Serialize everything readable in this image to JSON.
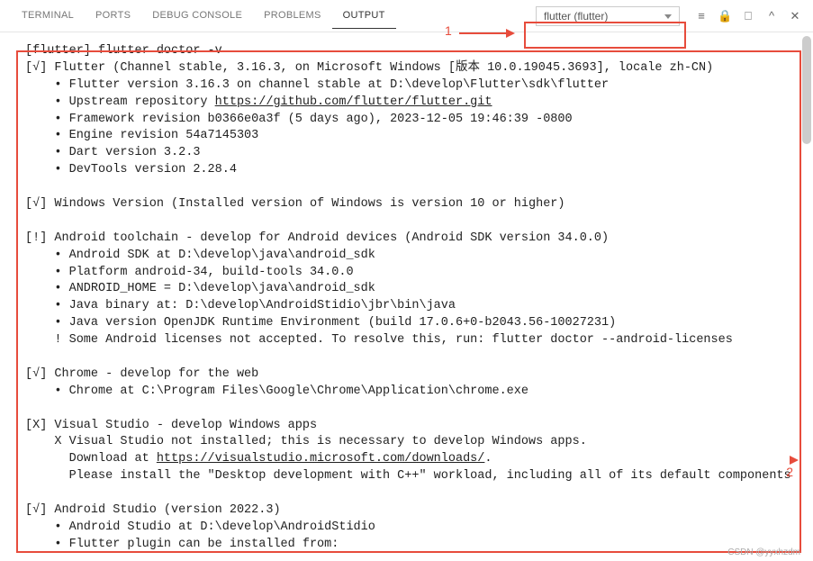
{
  "tabs": {
    "terminal": "TERMINAL",
    "ports": "PORTS",
    "debug_console": "DEBUG CONSOLE",
    "problems": "PROBLEMS",
    "output": "OUTPUT"
  },
  "filter": {
    "selected": "flutter (flutter)"
  },
  "annotations": {
    "label1": "1",
    "label2": "2"
  },
  "output": {
    "l01": "[flutter] flutter doctor -v",
    "l02": "[√] Flutter (Channel stable, 3.16.3, on Microsoft Windows [版本 10.0.19045.3693], locale zh-CN)",
    "l03": "    • Flutter version 3.16.3 on channel stable at D:\\develop\\Flutter\\sdk\\flutter",
    "l04a": "    • Upstream repository ",
    "l04b": "https://github.com/flutter/flutter.git",
    "l05": "    • Framework revision b0366e0a3f (5 days ago), 2023-12-05 19:46:39 -0800",
    "l06": "    • Engine revision 54a7145303",
    "l07": "    • Dart version 3.2.3",
    "l08": "    • DevTools version 2.28.4",
    "l09": "",
    "l10": "[√] Windows Version (Installed version of Windows is version 10 or higher)",
    "l11": "",
    "l12": "[!] Android toolchain - develop for Android devices (Android SDK version 34.0.0)",
    "l13": "    • Android SDK at D:\\develop\\java\\android_sdk",
    "l14": "    • Platform android-34, build-tools 34.0.0",
    "l15": "    • ANDROID_HOME = D:\\develop\\java\\android_sdk",
    "l16": "    • Java binary at: D:\\develop\\AndroidStidio\\jbr\\bin\\java",
    "l17": "    • Java version OpenJDK Runtime Environment (build 17.0.6+0-b2043.56-10027231)",
    "l18": "    ! Some Android licenses not accepted. To resolve this, run: flutter doctor --android-licenses",
    "l19": "",
    "l20": "[√] Chrome - develop for the web",
    "l21": "    • Chrome at C:\\Program Files\\Google\\Chrome\\Application\\chrome.exe",
    "l22": "",
    "l23": "[X] Visual Studio - develop Windows apps",
    "l24": "    X Visual Studio not installed; this is necessary to develop Windows apps.",
    "l25a": "      Download at ",
    "l25b": "https://visualstudio.microsoft.com/downloads/",
    "l25c": ".",
    "l26": "      Please install the \"Desktop development with C++\" workload, including all of its default components",
    "l27": "",
    "l28": "[√] Android Studio (version 2022.3)",
    "l29": "    • Android Studio at D:\\develop\\AndroidStidio",
    "l30": "    • Flutter plugin can be installed from:"
  },
  "watermark": "CSDN @yyxhzdm"
}
